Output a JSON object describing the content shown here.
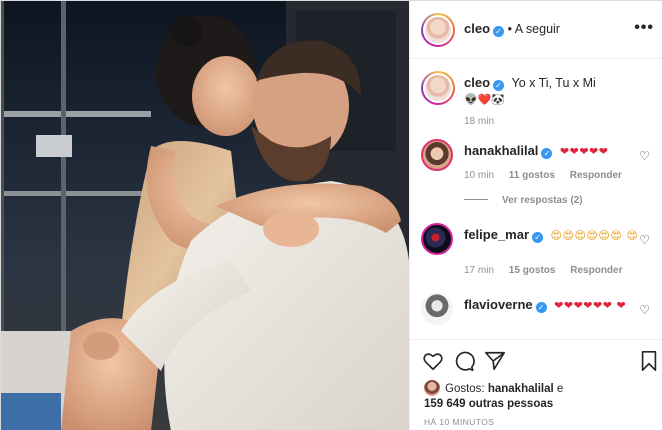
{
  "post": {
    "author": "cleo",
    "follow_label": "• A seguir",
    "more_label": "•••",
    "caption_text": "Yo x Ti, Tu x Mi",
    "caption_emojis": "👽❤️🐼",
    "caption_time": "18 min"
  },
  "comments": [
    {
      "username": "hanakhalilal",
      "text": "❤❤❤❤❤",
      "time": "10 min",
      "likes": "11 gostos",
      "reply": "Responder",
      "view_replies": "Ver respostas (2)"
    },
    {
      "username": "felipe_mar",
      "text": "😍😍😍😍😍😍 😍",
      "time": "17 min",
      "likes": "15 gostos",
      "reply": "Responder"
    },
    {
      "username": "flavioverne",
      "text": "❤❤❤❤❤❤ ❤"
    }
  ],
  "footer": {
    "liked_prefix": "Gostos:",
    "liked_user": "hanakhalilal",
    "liked_and": "e",
    "liked_count": "159 649 outras pessoas",
    "time_ago": "HÁ 10 MINUTOS"
  },
  "icons": {
    "like": "heart-outline-icon",
    "comment": "comment-bubble-icon",
    "share": "paper-plane-icon",
    "save": "bookmark-icon"
  },
  "colors": {
    "verified": "#3897f0",
    "heart": "#e0243c",
    "muted": "#8e8e8e",
    "text": "#262626"
  }
}
